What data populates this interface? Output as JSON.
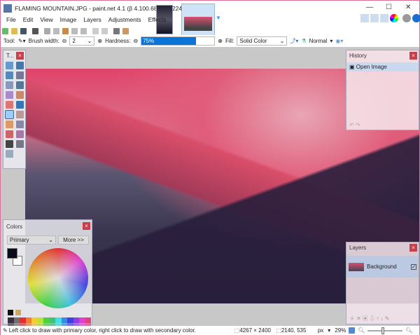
{
  "window": {
    "title": "FLAMING MOUNTAIN.JPG - paint.net 4.1 (β 4.100.6808.36224)",
    "minimize": "—",
    "maximize": "☐",
    "close": "✕"
  },
  "menu": [
    "File",
    "Edit",
    "View",
    "Image",
    "Layers",
    "Adjustments",
    "Effects"
  ],
  "tool_options": {
    "tool_label": "Tool:",
    "brush_width_label": "Brush width:",
    "brush_width": "2",
    "hardness_label": "Hardness:",
    "hardness": "75%",
    "hardness_value": 0.75,
    "fill_label": "Fill:",
    "fill": "Solid Color",
    "blend": "Normal"
  },
  "tools_panel": {
    "title": "T..."
  },
  "history": {
    "title": "History",
    "items": [
      "Open Image"
    ]
  },
  "colors": {
    "title": "Colors",
    "mode": "Primary",
    "more": "More >>",
    "primary": "#0a0a1a",
    "secondary": "#ffffff"
  },
  "layers": {
    "title": "Layers",
    "items": [
      {
        "name": "Background",
        "visible": true
      }
    ]
  },
  "status": {
    "hint": "Left click to draw with primary color, right click to draw with secondary color.",
    "size": "4267 × 2400",
    "pos": "2140, 535",
    "unit": "px",
    "zoom": "29%"
  },
  "palette": [
    "#3a3040",
    "#707070",
    "#e03030",
    "#f08030",
    "#f0d030",
    "#c0e030",
    "#50d040",
    "#40c080",
    "#40e0e0",
    "#3090e0",
    "#4040e0",
    "#9040e0",
    "#e040d0",
    "#e04080"
  ]
}
